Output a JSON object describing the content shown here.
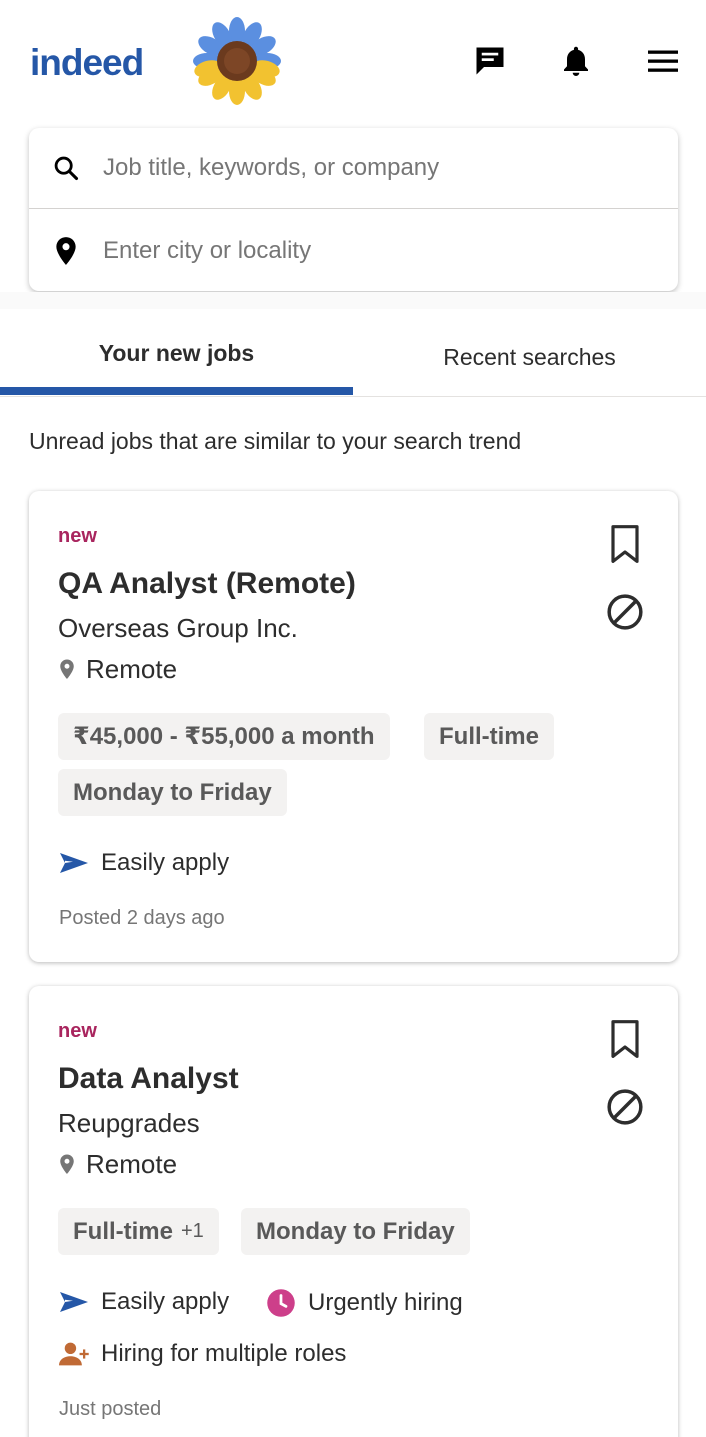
{
  "header": {
    "logo_text": "indeed",
    "icons": [
      "messages-icon",
      "notifications-bell-icon",
      "hamburger-menu-icon"
    ],
    "brand_color": "#2557a7"
  },
  "search": {
    "what_placeholder": "Job title, keywords, or company",
    "where_placeholder": "Enter city or locality"
  },
  "tabs": [
    {
      "label": "Your new jobs",
      "active": true
    },
    {
      "label": "Recent searches",
      "active": false
    }
  ],
  "subtitle": "Unread jobs that are similar to your search trend",
  "jobs": [
    {
      "badge": "new",
      "title": "QA Analyst (Remote)",
      "company": "Overseas Group Inc.",
      "location": "Remote",
      "chips": [
        "₹45,000 - ₹55,000 a month",
        "Full-time",
        "Monday to Friday"
      ],
      "features": [
        "Easily apply"
      ],
      "posted": "Posted 2 days ago"
    },
    {
      "badge": "new",
      "title": "Data Analyst",
      "company": "Reupgrades",
      "location": "Remote",
      "chips": [
        "Full-time",
        "Monday to Friday"
      ],
      "chip_extra": "+1",
      "features": [
        "Easily apply",
        "Urgently hiring",
        "Hiring for multiple roles"
      ],
      "posted": "Just posted"
    }
  ],
  "colors": {
    "accent": "#2557a7",
    "new_badge": "#a9255e",
    "urgent": "#cd3f8a",
    "multiple_roles": "#c06a35"
  }
}
